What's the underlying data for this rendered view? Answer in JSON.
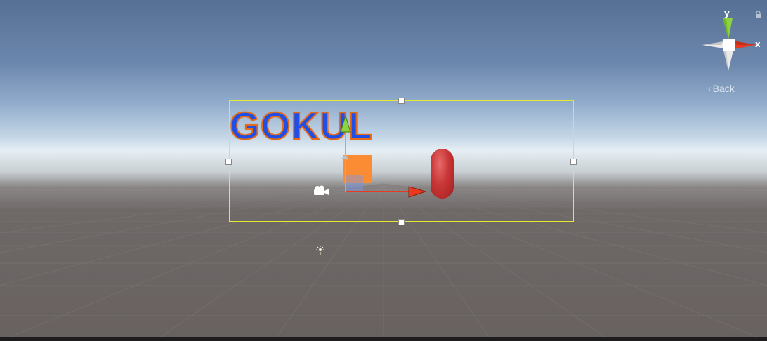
{
  "scene": {
    "ui_text": "GOKUL",
    "gizmo": {
      "y_label": "y",
      "x_label": "x",
      "back_label": "Back"
    }
  },
  "colors": {
    "sky_top": "#566f95",
    "ground": "#686160",
    "canvas_outline": "#e5e830",
    "text_fill": "#1f4fe6",
    "text_outline": "#e46b1a",
    "cube": "#fb8c34",
    "capsule": "#c83636",
    "axis_x": "#e83a1f",
    "axis_y": "#8bd33f"
  },
  "icons": [
    "camera-icon",
    "light-icon",
    "lock-icon",
    "scene-orientation-gizmo",
    "move-tool-gizmo"
  ]
}
